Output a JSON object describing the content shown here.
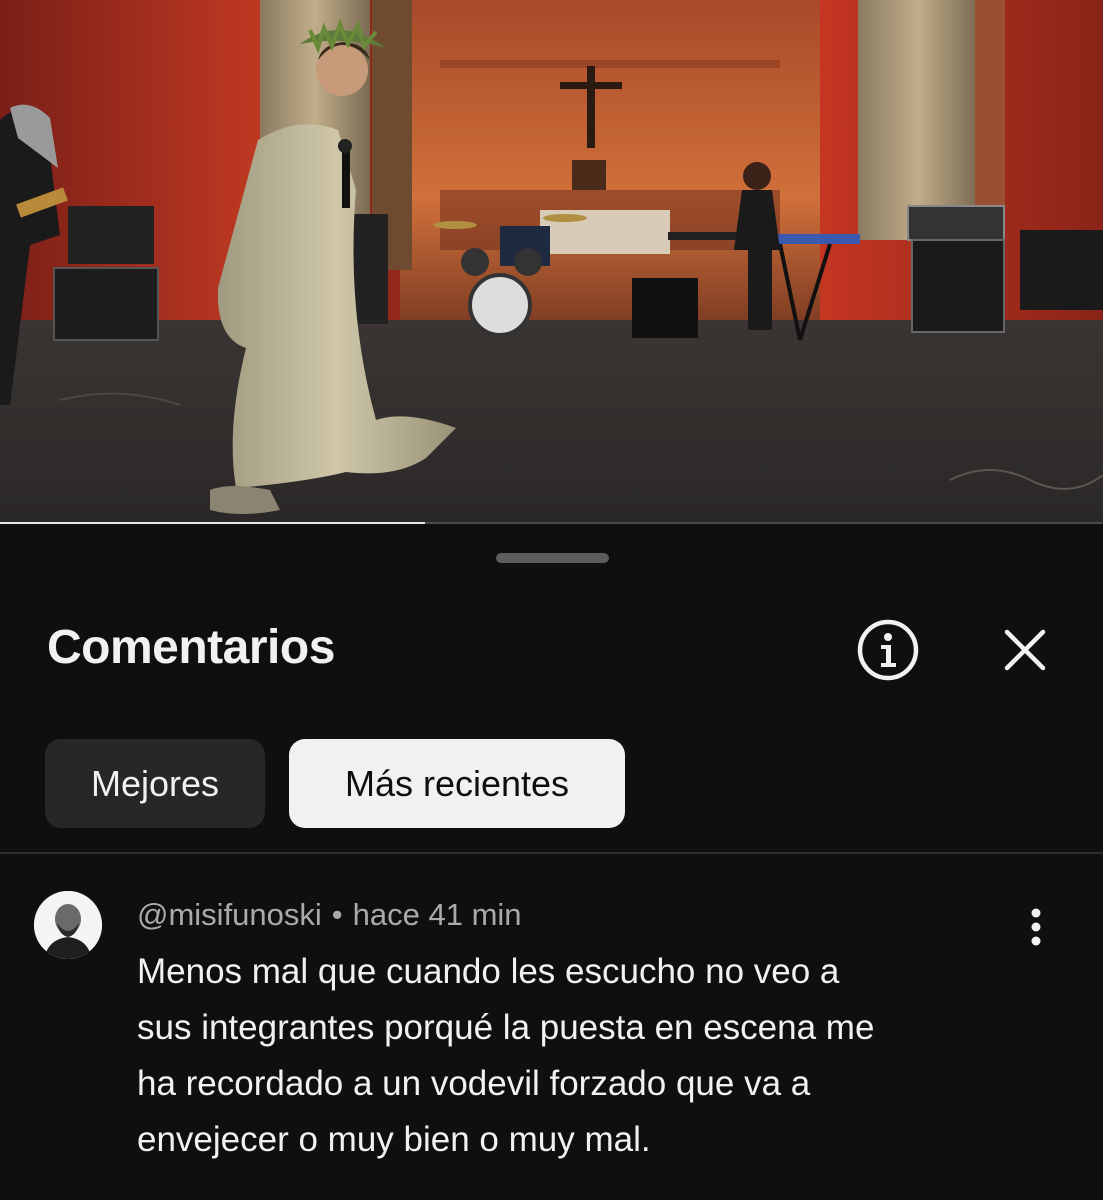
{
  "video": {
    "progress_fraction": 0.385
  },
  "sheet": {
    "title": "Comentarios",
    "info_icon": "info-circle-icon",
    "close_icon": "close-icon"
  },
  "filters": {
    "top_label": "Mejores",
    "recent_label": "Más recientes",
    "selected": "Más recientes"
  },
  "comment": {
    "author": "@misifunoski",
    "separator": "•",
    "time": "hace 41 min",
    "lines": [
      "Menos mal que cuando les escucho no veo a",
      "sus integrantes porqué la puesta en escena me",
      "ha recordado a un vodevil forzado que va a",
      "envejecer o muy bien o muy mal."
    ],
    "menu_icon": "more-vertical-icon"
  },
  "colors": {
    "background": "#0f0f0f",
    "chip_selected_bg": "#f1f1f1",
    "chip_bg": "#272727",
    "meta_text": "#aaaaaa",
    "stage_red": "#b02a1c"
  }
}
